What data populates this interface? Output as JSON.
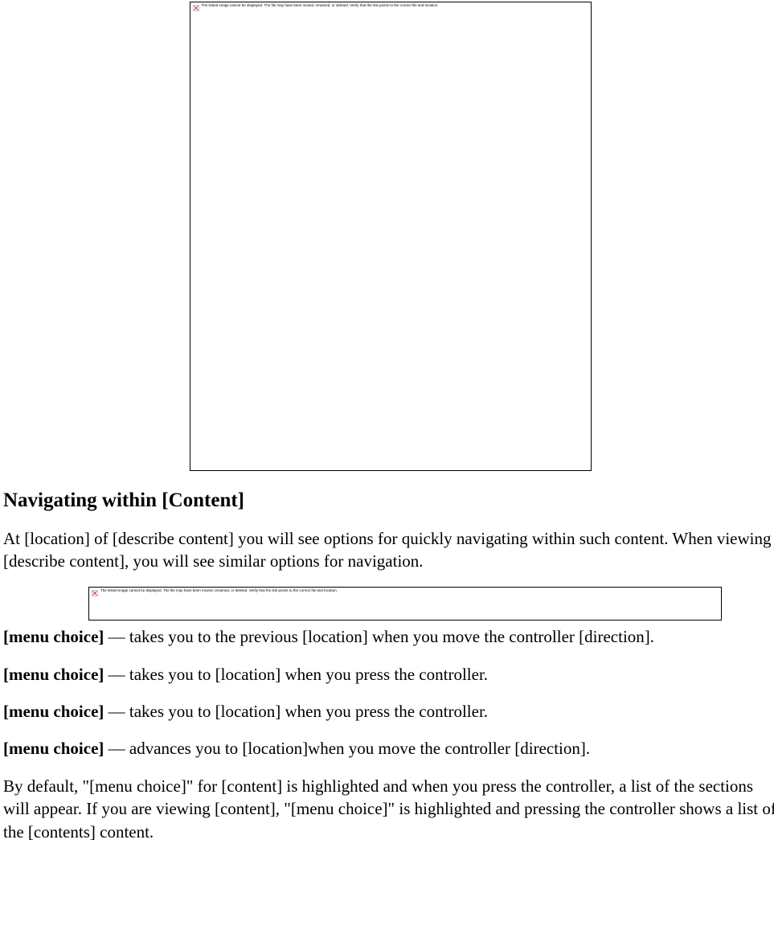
{
  "image1_alt": "The linked image cannot be displayed.  The file may have been moved, renamed, or deleted. Verify that the link points to the correct file and location.",
  "heading": "Navigating within [Content]",
  "intro_para": "At [location] of [describe content] you will see options for quickly navigating within such content. When viewing [describe content], you will see similar options for navigation.",
  "image2_alt": "The linked image cannot be displayed.  The file may have been moved, renamed, or deleted. Verify that the link points to the correct file and location.",
  "menu_items": [
    {
      "label": "[menu choice]",
      "desc": " — takes you to the previous [location] when you move the controller [direction]."
    },
    {
      "label": "[menu choice]",
      "desc": " — takes you to [location] when you press the controller."
    },
    {
      "label": "[menu choice]",
      "desc": " — takes you to [location] when you press the controller."
    },
    {
      "label": "[menu choice]",
      "desc": " — advances you to [location]when you move the controller [direction]."
    }
  ],
  "closing_para": "By default, \"[menu choice]\" for [content] is highlighted and when you press the controller, a list of the sections will appear. If you are viewing [content], \"[menu choice]\" is highlighted and pressing the controller shows a list of the [contents] content."
}
